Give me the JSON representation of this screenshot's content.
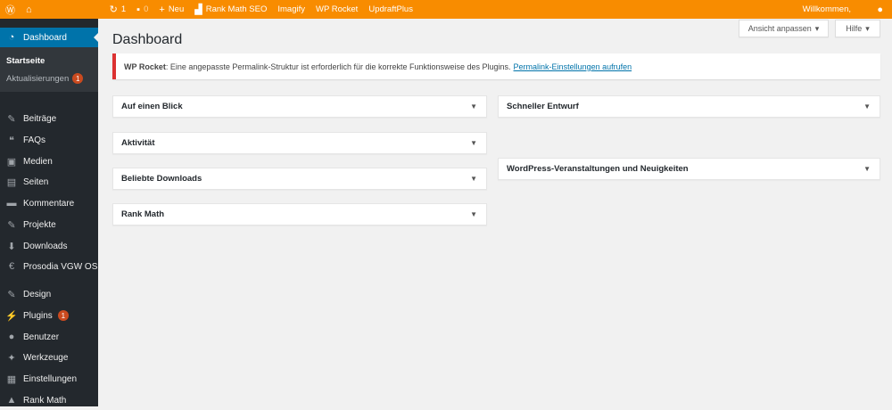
{
  "adminbar": {
    "updates": "1",
    "comments": "0",
    "new": "Neu",
    "items": [
      "Rank Math SEO",
      "Imagify",
      "WP Rocket",
      "UpdraftPlus"
    ],
    "welcome": "Willkommen,"
  },
  "sidebar": {
    "dashboard": "Dashboard",
    "sub": [
      "Startseite",
      "Aktualisierungen"
    ],
    "sub_badge": "1",
    "items": [
      {
        "label": "Beiträge",
        "icon": "✎"
      },
      {
        "label": "FAQs",
        "icon": "❝"
      },
      {
        "label": "Medien",
        "icon": "▣"
      },
      {
        "label": "Seiten",
        "icon": "▤"
      },
      {
        "label": "Kommentare",
        "icon": "▬"
      },
      {
        "label": "Projekte",
        "icon": "✎"
      },
      {
        "label": "Downloads",
        "icon": "⬇"
      },
      {
        "label": "Prosodia VGW OS",
        "icon": "€"
      },
      {
        "label": "Design",
        "icon": "✎"
      },
      {
        "label": "Plugins",
        "icon": "⚡",
        "badge": "1"
      },
      {
        "label": "Benutzer",
        "icon": "●"
      },
      {
        "label": "Werkzeuge",
        "icon": "✦"
      },
      {
        "label": "Einstellungen",
        "icon": "▦"
      },
      {
        "label": "Rank Math",
        "icon": "▲"
      }
    ]
  },
  "header": {
    "title": "Dashboard",
    "screen_options": "Ansicht anpassen",
    "help": "Hilfe"
  },
  "notice": {
    "strong": "WP Rocket",
    "text": ": Eine angepasste Permalink-Struktur ist erforderlich für die korrekte Funktionsweise des Plugins.",
    "link": "Permalink-Einstellungen aufrufen"
  },
  "widgets": {
    "left": [
      "Auf einen Blick",
      "Aktivität",
      "Beliebte Downloads",
      "Rank Math"
    ],
    "right": [
      "Schneller Entwurf",
      "WordPress-Veranstaltungen und Neuigkeiten"
    ]
  },
  "colors": {
    "adminbar": "#f88c00",
    "sidebar": "#23282d",
    "active": "#0073aa",
    "notice_border": "#dc3232"
  }
}
